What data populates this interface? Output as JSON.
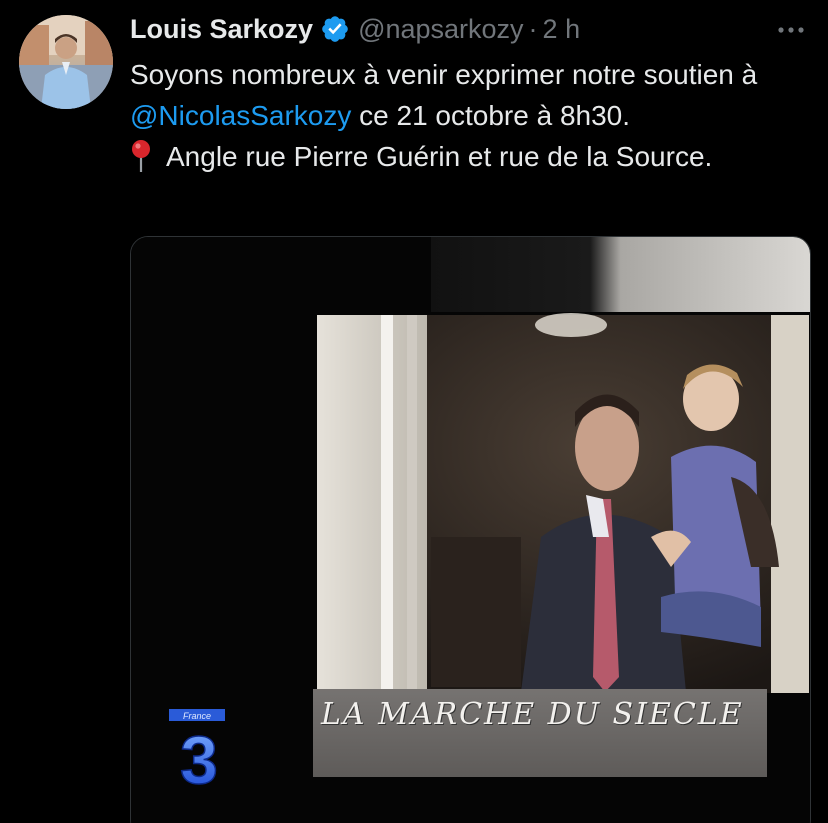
{
  "author": {
    "display_name": "Louis Sarkozy",
    "handle": "@napsarkozy",
    "separator": "·",
    "time": "2 h",
    "verified_icon": "verified-badge-icon",
    "verified_color": "#1d9bf0"
  },
  "tweet": {
    "text_part1": "Soyons nombreux à venir exprimer notre soutien à ",
    "mention": "@NicolasSarkozy",
    "text_part2": " ce 21 octobre à 8h30.",
    "location_icon": "round-pushpin-icon",
    "location_text": "Angle rue Pierre Guérin et rue de la Source."
  },
  "media": {
    "channel_logo_text": "France",
    "channel_logo_number": "3",
    "caption": "LA MARCHE DU SIECLE"
  },
  "colors": {
    "background": "#000000",
    "text": "#e7e9ea",
    "secondary_text": "#71767b",
    "link": "#1d9bf0"
  }
}
